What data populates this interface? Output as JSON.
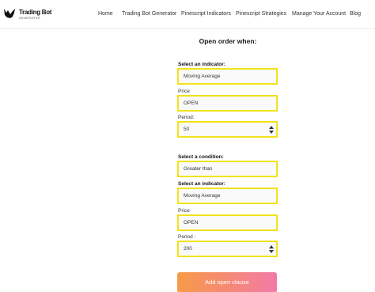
{
  "header": {
    "logo": {
      "title": "Trading Bot",
      "subtitle": "GENERATOR"
    },
    "nav": [
      "Home",
      "Trading Bot Generator",
      "Pinescript Indicators",
      "Pinescript Strategies",
      "Manage Your Account",
      "Blog"
    ]
  },
  "form": {
    "title": "Open order when:",
    "first_indicator": {
      "label": "Select an indicator:",
      "value": "Moving Average",
      "price_label": "Price",
      "price_value": "OPEN",
      "period_label": "Period:",
      "period_value": "50"
    },
    "condition": {
      "label": "Select a condition:",
      "value": "Greater than"
    },
    "second_indicator": {
      "label": "Select an indicator:",
      "value": "Moving Average",
      "price_label": "Price",
      "price_value": "OPEN",
      "period_label": "Period :",
      "period_value": "200"
    },
    "add_button": "Add open clause"
  },
  "colors": {
    "field_border": "#f2e21a",
    "button_gradient": [
      "#f69a48",
      "#f27aa8"
    ]
  }
}
